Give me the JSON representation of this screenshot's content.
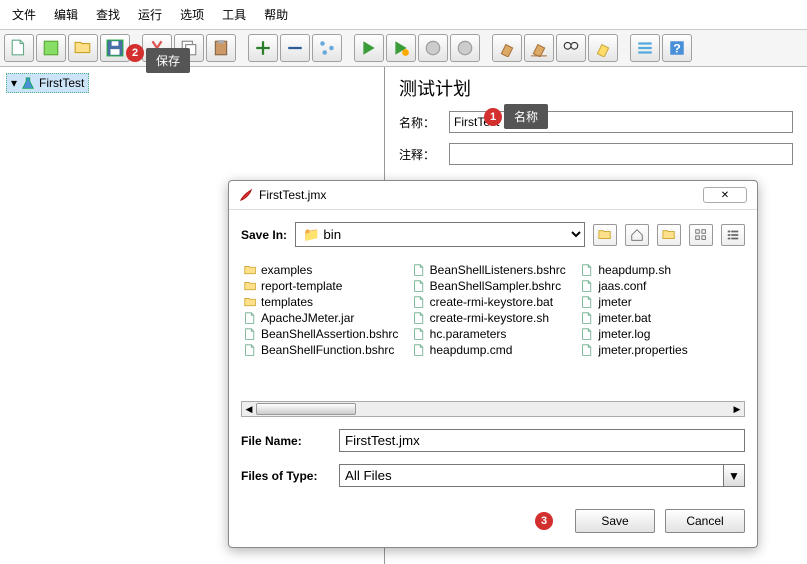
{
  "menu": [
    "文件",
    "编辑",
    "查找",
    "运行",
    "选项",
    "工具",
    "帮助"
  ],
  "tooltips": {
    "save": "保存",
    "name": "名称"
  },
  "tree": {
    "item": "FirstTest"
  },
  "panel": {
    "title": "测试计划",
    "name_label": "名称：",
    "name_value": "FirstTest",
    "comment_label": "注释："
  },
  "dialog": {
    "title": "FirstTest.jmx",
    "savein_label": "Save In:",
    "savein_value": "bin",
    "files_col1": [
      {
        "t": "folder",
        "n": "examples"
      },
      {
        "t": "folder",
        "n": "report-template"
      },
      {
        "t": "folder",
        "n": "templates"
      },
      {
        "t": "file",
        "n": "ApacheJMeter.jar"
      },
      {
        "t": "file",
        "n": "BeanShellAssertion.bshrc"
      },
      {
        "t": "file",
        "n": "BeanShellFunction.bshrc"
      }
    ],
    "files_col2": [
      {
        "t": "file",
        "n": "BeanShellListeners.bshrc"
      },
      {
        "t": "file",
        "n": "BeanShellSampler.bshrc"
      },
      {
        "t": "file",
        "n": "create-rmi-keystore.bat"
      },
      {
        "t": "file",
        "n": "create-rmi-keystore.sh"
      },
      {
        "t": "file",
        "n": "hc.parameters"
      },
      {
        "t": "file",
        "n": "heapdump.cmd"
      }
    ],
    "files_col3": [
      {
        "t": "file",
        "n": "heapdump.sh"
      },
      {
        "t": "file",
        "n": "jaas.conf"
      },
      {
        "t": "file",
        "n": "jmeter"
      },
      {
        "t": "file",
        "n": "jmeter.bat"
      },
      {
        "t": "file",
        "n": "jmeter.log"
      },
      {
        "t": "file",
        "n": "jmeter.properties"
      }
    ],
    "filename_label": "File Name:",
    "filename_value": "FirstTest.jmx",
    "filetype_label": "Files of Type:",
    "filetype_value": "All Files",
    "save_btn": "Save",
    "cancel_btn": "Cancel"
  },
  "badges": {
    "b1": "1",
    "b2": "2",
    "b3": "3"
  }
}
